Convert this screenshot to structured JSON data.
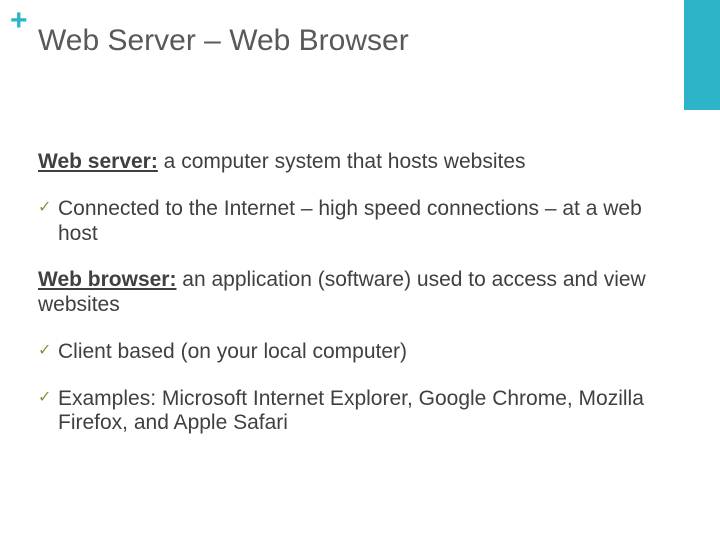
{
  "accentColor": "#2eb4c8",
  "plus": "+",
  "title": "Web Server – Web Browser",
  "body": {
    "p1_bold": "Web server:",
    "p1_rest": " a computer system that hosts websites",
    "c1": "Connected to the Internet – high speed connections – at a web host",
    "p2_bold": "Web browser:",
    "p2_rest": " an application (software) used to access and view websites",
    "c2": "Client based (on your local computer)",
    "c3": "Examples: Microsoft Internet Explorer, Google Chrome, Mozilla Firefox, and Apple Safari"
  },
  "checkGlyph": "✓"
}
